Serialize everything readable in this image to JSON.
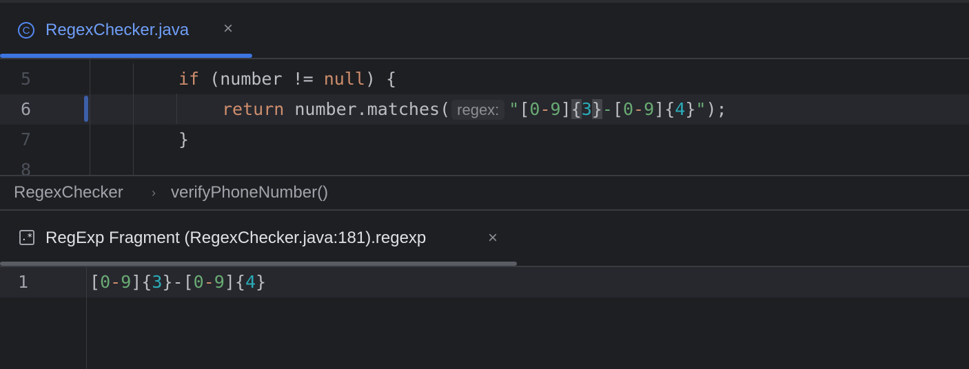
{
  "editor_tab": {
    "label": "RegexChecker.java",
    "icon": "java-class-icon",
    "close": "×"
  },
  "code_lines": [
    {
      "number": "5",
      "tokens": [
        [
          "kw",
          "if"
        ],
        [
          "",
          " (number != "
        ],
        [
          "kw",
          "null"
        ],
        [
          "",
          ") {"
        ]
      ]
    },
    {
      "number": "6"
    },
    {
      "number": "7",
      "text": "}"
    },
    {
      "number": "8"
    }
  ],
  "line6": {
    "kw": "return",
    "call": " number.matches(",
    "hint": "regex:",
    "q1": "\"",
    "lb1": "[",
    "d0a": "0",
    "dash1": "-",
    "d9a": "9",
    "rb1": "]",
    "lc1": "{",
    "n3": "3",
    "rc1": "}",
    "dash2": "-",
    "lb2": "[",
    "d0b": "0",
    "dash3": "-",
    "d9b": "9",
    "rb2": "]",
    "lc2": "{",
    "n4": "4",
    "rc2": "}",
    "q2": "\"",
    "end": ");"
  },
  "breadcrumb": {
    "class": "RegexChecker",
    "sep": "›",
    "method": "verifyPhoneNumber()"
  },
  "fragment_tab": {
    "label": "RegExp Fragment (RegexChecker.java:181).regexp",
    "icon": "regexp-file-icon",
    "icon_text": ".*",
    "close": "×"
  },
  "fragment": {
    "line_number": "1",
    "parts": {
      "lb1": "[",
      "d0a": "0",
      "dash1": "-",
      "d9a": "9",
      "rb1": "]",
      "lc1": "{",
      "n3": "3",
      "rc1": "}",
      "dash2": "-",
      "lb2": "[",
      "d0b": "0",
      "dash3": "-",
      "d9b": "9",
      "rb2": "]",
      "lc2": "{",
      "n4": "4",
      "rc2": "}"
    }
  }
}
